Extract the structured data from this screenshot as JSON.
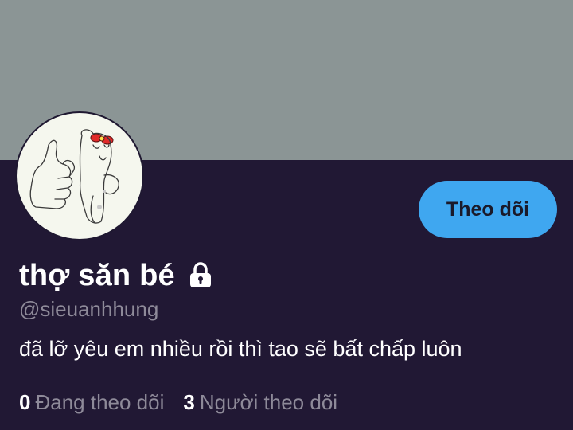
{
  "profile": {
    "display_name": "thợ săn bé",
    "handle": "@sieuanhhung",
    "bio": "đã lỡ yêu em nhiều rồi thì tao sẽ bất chấp luôn",
    "protected_icon": "lock-icon",
    "avatar_icon": "thumbs-up-cartoon-avatar"
  },
  "actions": {
    "follow_label": "Theo dõi"
  },
  "stats": {
    "following_count": "0",
    "following_label": "Đang theo dõi",
    "followers_count": "3",
    "followers_label": "Người theo dõi"
  },
  "colors": {
    "banner": "#8b9595",
    "background": "#211834",
    "accent": "#3fa7f0",
    "secondary_text": "#8e8a99"
  }
}
